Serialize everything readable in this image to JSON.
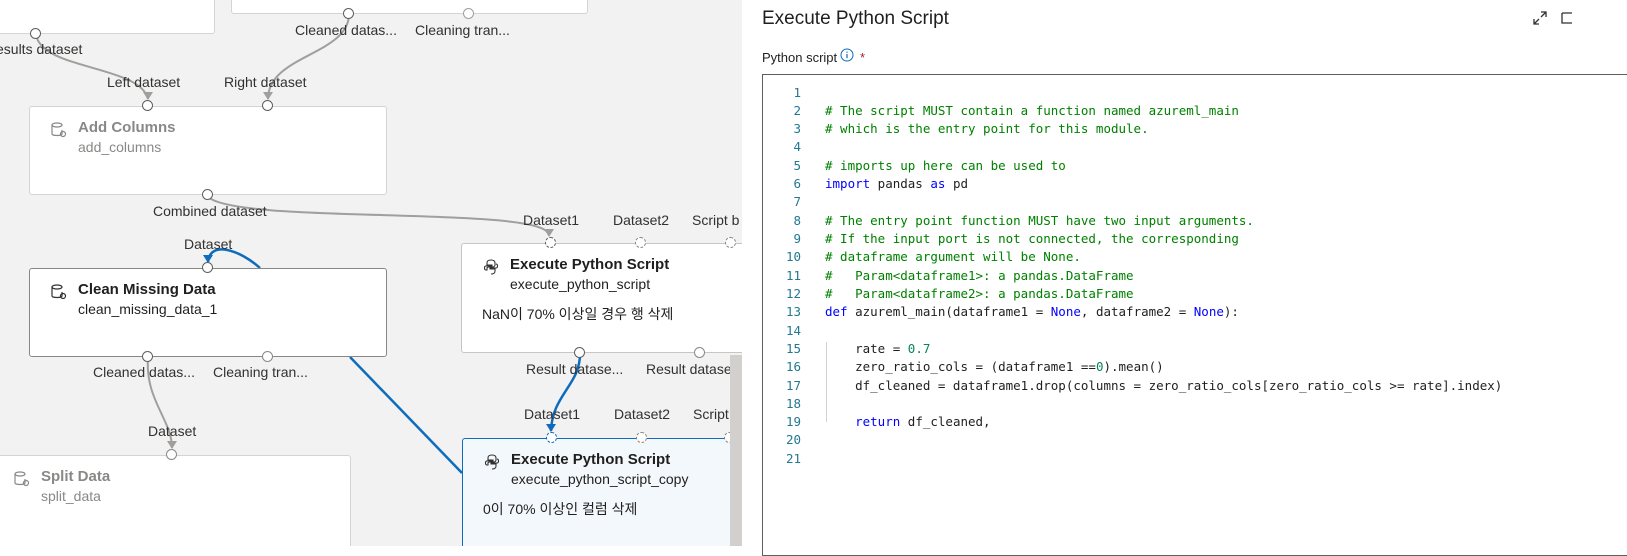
{
  "canvas": {
    "ports": {
      "results_dataset": "esults dataset",
      "cleaned_top": "Cleaned datas...",
      "cleaning_top": "Cleaning tran...",
      "left_dataset": "Left dataset",
      "right_dataset": "Right dataset",
      "combined_dataset": "Combined dataset",
      "dataset_clean_in": "Dataset",
      "dataset1_a": "Dataset1",
      "dataset2_a": "Dataset2",
      "script_b_a": "Script b",
      "cleaned_bottom": "Cleaned datas...",
      "cleaning_bottom": "Cleaning tran...",
      "result_dataset_1": "Result datase...",
      "result_dataset_2": "Result datase",
      "dataset_split_in": "Dataset",
      "dataset1_b": "Dataset1",
      "dataset2_b": "Dataset2",
      "script_b": "Script"
    },
    "nodes": {
      "add_columns": {
        "title": "Add Columns",
        "subtitle": "add_columns"
      },
      "clean_missing": {
        "title": "Clean Missing Data",
        "subtitle": "clean_missing_data_1"
      },
      "execute_1": {
        "title": "Execute Python Script",
        "subtitle": "execute_python_script",
        "comment": "NaN이 70% 이상일 경우 행 삭제"
      },
      "split_data": {
        "title": "Split Data",
        "subtitle": "split_data"
      },
      "execute_2": {
        "title": "Execute Python Script",
        "subtitle": "execute_python_script_copy",
        "comment": "0이 70% 이상인 컬럼 삭제"
      }
    },
    "colors": {
      "selected_wire": "#0f6cbd",
      "wire": "#a19f9d"
    }
  },
  "panel": {
    "title": "Execute Python Script",
    "field_label": "Python script",
    "required_mark": "*",
    "icons": [
      "expand-icon",
      "info-icon",
      "database-settings-icon",
      "python-icon"
    ],
    "code": {
      "line_numbers": [
        "1",
        "2",
        "3",
        "4",
        "5",
        "6",
        "7",
        "8",
        "9",
        "10",
        "11",
        "12",
        "13",
        "14",
        "15",
        "16",
        "17",
        "18",
        "19",
        "20",
        "21"
      ],
      "line2": "# The script MUST contain a function named azureml_main",
      "line3": "# which is the entry point for this module.",
      "line5": "# imports up here can be used to",
      "line6_kw1": "import",
      "line6_mid": " pandas ",
      "line6_kw2": "as",
      "line6_end": " pd",
      "line8": "# The entry point function MUST have two input arguments.",
      "line9": "# If the input port is not connected, the corresponding",
      "line10": "# dataframe argument will be None.",
      "line11": "#   Param<dataframe1>: a pandas.DataFrame",
      "line12": "#   Param<dataframe2>: a pandas.DataFrame",
      "line13_kw": "def",
      "line13_a": " azureml_main(dataframe1 = ",
      "line13_none1": "None",
      "line13_b": ", dataframe2 = ",
      "line13_none2": "None",
      "line13_c": "):",
      "line15_a": "    rate = ",
      "line15_num": "0.7",
      "line16_a": "    zero_ratio_cols = (dataframe1 ==",
      "line16_num": "0",
      "line16_b": ").mean()",
      "line17": "    df_cleaned = dataframe1.drop(columns = zero_ratio_cols[zero_ratio_cols >= rate].index)",
      "line19_kw": "    return",
      "line19_end": " df_cleaned,"
    }
  }
}
